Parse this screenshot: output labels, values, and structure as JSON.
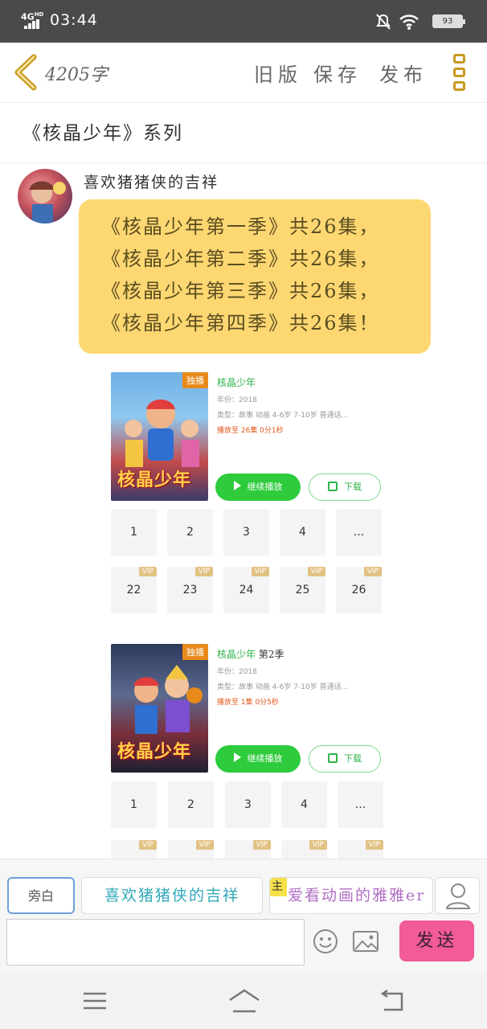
{
  "status_bar": {
    "network": "4G",
    "network_sup": "HD",
    "time": "03:44",
    "battery": "93"
  },
  "header": {
    "word_count": "4205字",
    "actions": [
      {
        "label": "旧版"
      },
      {
        "label": "保存"
      },
      {
        "label": "发布"
      }
    ]
  },
  "series_title": "《核晶少年》系列",
  "message": {
    "speaker": "喜欢猪猪侠的吉祥",
    "lines": [
      "《核晶少年第一季》共26集，",
      "《核晶少年第二季》共26集，",
      "《核晶少年第三季》共26集，",
      "《核晶少年第四季》共26集！"
    ]
  },
  "cards": [
    {
      "badge": "独播",
      "poster_logo": "核晶少年",
      "title": "核晶少年",
      "season": "",
      "year": "年份：2018",
      "type": "类型：故事  动画  4-6岁  7-10岁  普通话…",
      "progress": "播放至 26集 0分1秒",
      "play_label": "继续播放",
      "download_label": "下载",
      "episodes": [
        {
          "label": "1",
          "vip": ""
        },
        {
          "label": "2",
          "vip": ""
        },
        {
          "label": "3",
          "vip": ""
        },
        {
          "label": "4",
          "vip": ""
        },
        {
          "label": "...",
          "vip": ""
        },
        {
          "label": "22",
          "vip": "VIP"
        },
        {
          "label": "23",
          "vip": "VIP"
        },
        {
          "label": "24",
          "vip": "VIP"
        },
        {
          "label": "25",
          "vip": "VIP"
        },
        {
          "label": "26",
          "vip": "VIP"
        }
      ]
    },
    {
      "badge": "独播",
      "poster_logo": "核晶少年",
      "title": "核晶少年",
      "season": "第2季",
      "year": "年份：2018",
      "type": "类型：故事  动画  4-6岁  7-10岁  普通话…",
      "progress": "播放至 1集 0分5秒",
      "play_label": "继续播放",
      "download_label": "下载",
      "episodes": [
        {
          "label": "1",
          "vip": ""
        },
        {
          "label": "2",
          "vip": ""
        },
        {
          "label": "3",
          "vip": ""
        },
        {
          "label": "4",
          "vip": ""
        },
        {
          "label": "...",
          "vip": ""
        },
        {
          "label": "",
          "vip": "VIP"
        },
        {
          "label": "",
          "vip": "VIP"
        },
        {
          "label": "",
          "vip": "VIP"
        },
        {
          "label": "",
          "vip": "VIP"
        },
        {
          "label": "",
          "vip": "VIP"
        }
      ]
    }
  ],
  "composer": {
    "roles": [
      {
        "label": "旁白"
      },
      {
        "label": "喜欢猪猪侠的吉祥"
      },
      {
        "label": "爱看动画的雅雅er",
        "host_tag": "主"
      }
    ],
    "input_value": "",
    "send_label": "发送"
  },
  "colors": {
    "accent_green": "#2ecb3c",
    "bubble_yellow": "#fdd772",
    "send_pink": "#f25a98",
    "back_gold": "#c79a1f"
  }
}
